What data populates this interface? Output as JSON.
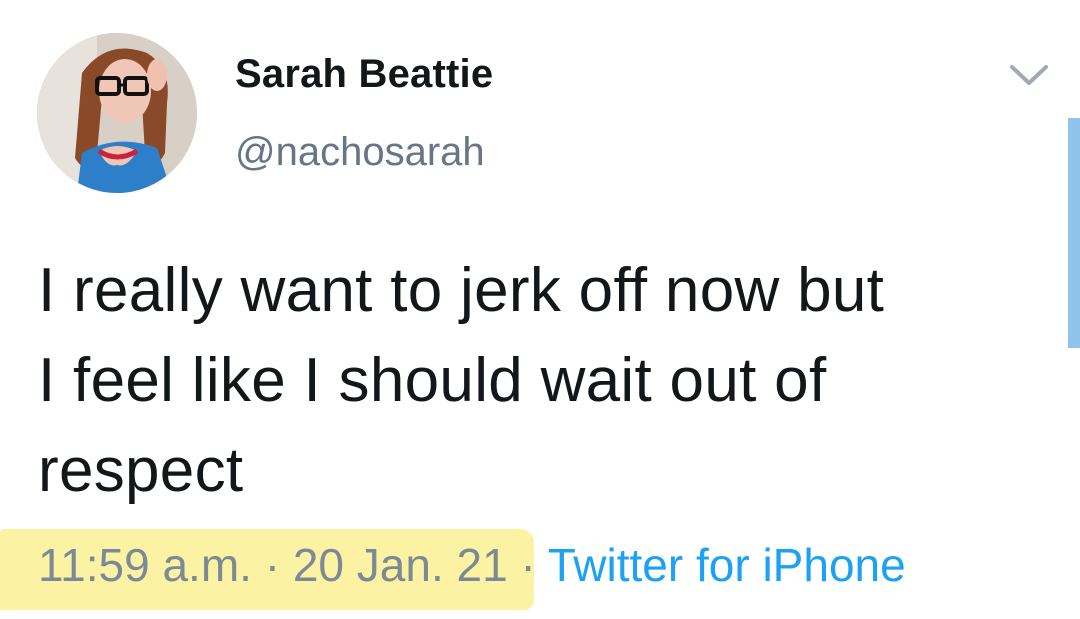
{
  "user": {
    "display_name": "Sarah Beattie",
    "handle": "@nachosarah"
  },
  "tweet": {
    "text_lines": [
      "I really want to jerk off now but",
      "I feel like I should wait out of",
      "respect"
    ]
  },
  "meta": {
    "time": "11:59 a.m.",
    "separator": "·",
    "date": "20 Jan. 21",
    "source": "Twitter for iPhone"
  },
  "icons": {
    "menu": "chevron-down-icon",
    "avatar": "profile-photo"
  },
  "colors": {
    "text": "#14171a",
    "secondary": "#657786",
    "link": "#1da1f2",
    "highlight": "#fbf3a3"
  }
}
